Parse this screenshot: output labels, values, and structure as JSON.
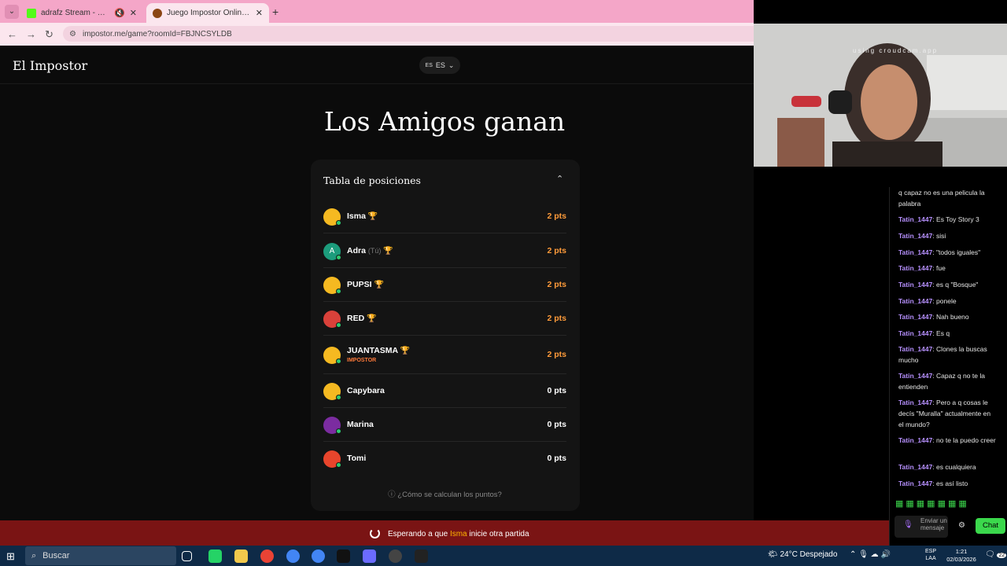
{
  "browser": {
    "tabs": [
      {
        "title": "adrafz Stream - Watch Live",
        "active": false,
        "icon": "kick-icon",
        "color": "#53fc18"
      },
      {
        "title": "Juego Impostor Online Gratis",
        "active": true,
        "icon": "impostor-icon",
        "color": "#8b4513"
      }
    ],
    "url": "impostor.me/game?roomId=FBJNCSYLDB",
    "new_tab_glyph": "+"
  },
  "app": {
    "title": "El Impostor",
    "language_flag": "ES",
    "language": "ES"
  },
  "result": {
    "headline": "Los Amigos ganan"
  },
  "leaderboard": {
    "title": "Tabla de posiciones",
    "players": [
      {
        "name": "Isma",
        "you": "",
        "role": "",
        "trophy": "🏆",
        "points": "2 pts",
        "avatar_color": "#f5b921",
        "winner": true
      },
      {
        "name": "Adra",
        "you": "(Tú)",
        "role": "",
        "trophy": "🏆",
        "points": "2 pts",
        "avatar_color": "#1c9c7c",
        "avatar_letter": "A",
        "winner": true
      },
      {
        "name": "PUPSI",
        "you": "",
        "role": "",
        "trophy": "🏆",
        "points": "2 pts",
        "avatar_color": "#f5b921",
        "winner": true
      },
      {
        "name": "RED",
        "you": "",
        "role": "",
        "trophy": "🏆",
        "points": "2 pts",
        "avatar_color": "#d9413a",
        "winner": true
      },
      {
        "name": "JUANTASMA",
        "you": "",
        "role": "IMPOSTOR",
        "trophy": "🏆",
        "points": "2 pts",
        "avatar_color": "#f5b921",
        "winner": true
      },
      {
        "name": "Capybara",
        "you": "",
        "role": "",
        "trophy": "",
        "points": "0 pts",
        "avatar_color": "#f5b921",
        "winner": false
      },
      {
        "name": "Marina",
        "you": "",
        "role": "",
        "trophy": "",
        "points": "0 pts",
        "avatar_color": "#7b2ca0",
        "winner": false
      },
      {
        "name": "Tomi",
        "you": "",
        "role": "",
        "trophy": "",
        "points": "0 pts",
        "avatar_color": "#e8452c",
        "winner": false
      }
    ],
    "points_help": "¿Cómo se calculan los puntos?"
  },
  "footer": {
    "prefix": "Esperando a que",
    "host": "Isma",
    "suffix": "inicie otra partida"
  },
  "webcam": {
    "watermark": "using croudcam.app"
  },
  "chat": {
    "messages": [
      {
        "user": "",
        "text": "q capaz no es una pelicula la palabra"
      },
      {
        "user": "Tatin_1447",
        "text": ": Es Toy Story 3"
      },
      {
        "user": "Tatin_1447",
        "text": ": sisi"
      },
      {
        "user": "Tatin_1447",
        "text": ": \"todos iguales\""
      },
      {
        "user": "Tatin_1447",
        "text": ": fue"
      },
      {
        "user": "Tatin_1447",
        "text": ": es q \"Bosque\""
      },
      {
        "user": "Tatin_1447",
        "text": ": ponele"
      },
      {
        "user": "Tatin_1447",
        "text": ": Nah bueno"
      },
      {
        "user": "Tatin_1447",
        "text": ": Es q"
      },
      {
        "user": "Tatin_1447",
        "text": ": Clones la buscas mucho"
      },
      {
        "user": "Tatin_1447",
        "text": ": Capaz q no te la entienden"
      },
      {
        "user": "Tatin_1447",
        "text": ": Pero a q cosas le decís \"Muralla\" actualmente en el mundo?"
      },
      {
        "user": "Tatin_1447",
        "text": ": no te la puedo creer"
      },
      {
        "user": "Tatin_1447",
        "text": ": es cualquiera"
      },
      {
        "user": "Tatin_1447",
        "text": ": es así listo"
      }
    ],
    "emotes": "▦▦▦▦▦▦▦",
    "input_placeholder": "Enviar un mensaje",
    "send_label": "Chat"
  },
  "taskbar": {
    "search_placeholder": "Buscar",
    "weather": "24°C  Despejado",
    "input_lang_1": "ESP",
    "input_lang_2": "LAA",
    "time": "1:21",
    "date": "02/03/2026",
    "notification_count": "22",
    "apps": [
      "task-view-icon",
      "whatsapp-icon",
      "file-explorer-icon",
      "chrome-profile-icon",
      "chrome-icon",
      "chrome-alt-icon",
      "tiktok-icon",
      "obs-icon",
      "chrome-webcam-icon",
      "app-icon"
    ],
    "accent": "#0e2a47"
  }
}
